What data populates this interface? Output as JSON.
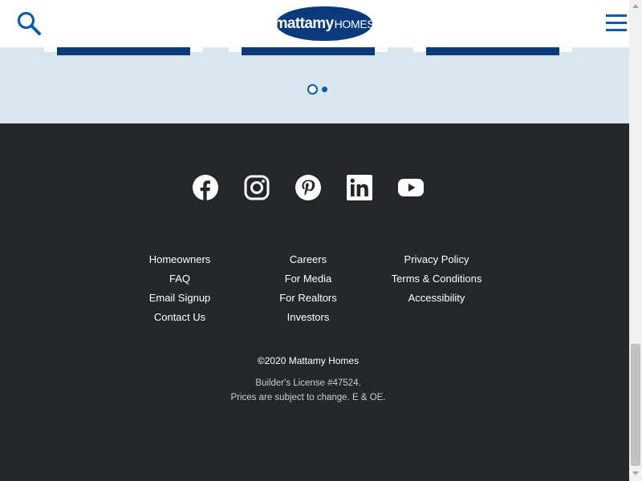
{
  "header": {
    "logo_brand": "mattamy",
    "logo_homes": "HOMES",
    "search_icon": "search-icon",
    "menu_icon": "hamburger-menu-icon",
    "accent_color": "#0b5cab",
    "brand_color": "#0b3a7a"
  },
  "carousel": {
    "current_page": 1,
    "page_count": 2
  },
  "footer": {
    "social": [
      "facebook-icon",
      "instagram-icon",
      "pinterest-icon",
      "linkedin-icon",
      "youtube-icon"
    ],
    "links_col1": [
      "Homeowners",
      "FAQ",
      "Email Signup",
      "Contact Us"
    ],
    "links_col2": [
      "Careers",
      "For Media",
      "For Realtors",
      "Investors"
    ],
    "links_col3": [
      "Privacy Policy",
      "Terms & Conditions",
      "Accessibility"
    ],
    "copyright": "©2020 Mattamy Homes",
    "license_line1": "Builder's License #47524.",
    "license_line2": "Prices are subject to change. E & OE.",
    "background_color": "#23272b"
  }
}
